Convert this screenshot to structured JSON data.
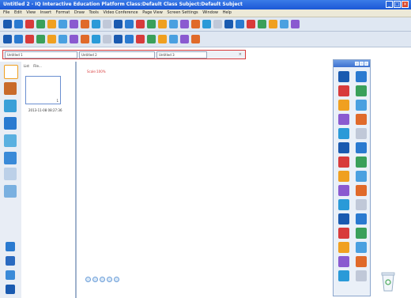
{
  "window": {
    "title": "Untitled 2 - IQ Interactive Education Platform  Class:Default Class  Subject:Default Subject"
  },
  "menu": [
    "File",
    "Edit",
    "View",
    "Insert",
    "Format",
    "Draw",
    "Tools",
    "Video Conference",
    "Page View",
    "Screen Settings",
    "Window",
    "Help"
  ],
  "tabs": [
    {
      "label": "Untitled 1"
    },
    {
      "label": "Untitled 2"
    },
    {
      "label": "Untitled 3"
    }
  ],
  "tab_close": "×",
  "thumbnails": {
    "tabs": [
      "List",
      "File..."
    ],
    "page_number": "1",
    "date": "2013-11-08 08:27:36"
  },
  "canvas": {
    "scale": "Scale:100%"
  },
  "colors": {
    "titlebar": "#1b58d6",
    "accent_red": "#d83b3b",
    "toolbar_bg": "#dfe7f2"
  },
  "toolbar1": [
    "new-icon",
    "open-icon",
    "save-icon",
    "print-icon",
    "undo-icon",
    "redo-icon",
    "cut-icon",
    "copy-icon",
    "paste-icon",
    "delete-icon",
    "zoom-icon",
    "ruler-icon",
    "protractor-icon",
    "compass-icon",
    "screen-icon",
    "capture-icon",
    "record-icon",
    "camera-icon",
    "film-icon",
    "play-icon",
    "stop-icon",
    "spotlight-icon",
    "curtain-icon",
    "magnifier-icon",
    "calculator-icon",
    "keyboard-icon",
    "browser-icon"
  ],
  "toolbar2": [
    "select-icon",
    "pen-icon",
    "brush-icon",
    "highlighter-icon",
    "eraser-icon",
    "line-icon",
    "shape-icon",
    "fill-icon",
    "text-icon",
    "table-icon",
    "image-icon",
    "sound-icon",
    "link-icon",
    "group-icon",
    "align-icon",
    "rotate-icon",
    "layer-icon",
    "lock-icon"
  ],
  "sidebar": [
    "page-icon",
    "library-icon",
    "resource-icon",
    "media-icon",
    "attachment-icon",
    "chart-icon",
    "question-icon",
    "vote-icon"
  ],
  "sidebar_bottom": [
    "tools-icon",
    "users-icon",
    "print-icon",
    "settings-icon"
  ],
  "palette": [
    "select-icon",
    "roam-icon",
    "pen-icon",
    "brush-icon",
    "pencil-icon",
    "highlighter-icon",
    "marker-icon",
    "eraser-icon",
    "line-icon",
    "shape-icon",
    "fill-icon",
    "triangle-icon",
    "polygon-icon",
    "color-icon",
    "rectangle-icon",
    "text-icon",
    "ruler-icon",
    "angle-icon",
    "pointer-icon",
    "arrow-icon",
    "zoom-icon",
    "spotlight-icon",
    "screen-icon",
    "hide-icon",
    "capture-icon",
    "record-icon",
    "lock-icon",
    "settings-icon",
    "minimize-icon",
    "close-icon"
  ],
  "recycle": "recycle-bin-icon"
}
